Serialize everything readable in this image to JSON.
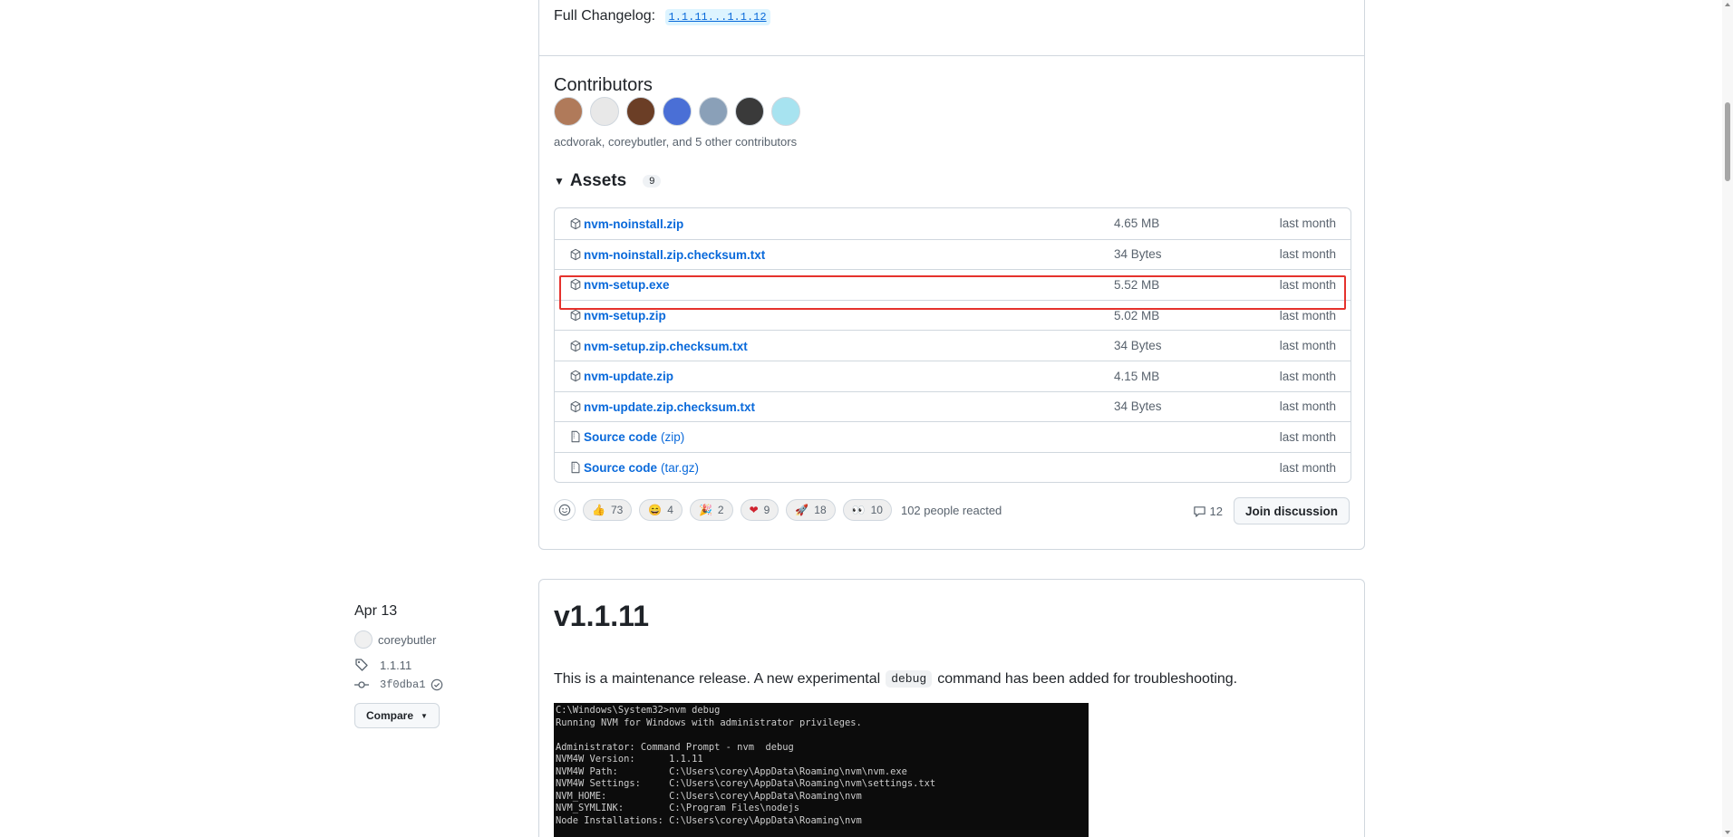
{
  "changelog": {
    "label": "Full Changelog:",
    "link": "1.1.11...1.1.12"
  },
  "contributors": {
    "title": "Contributors",
    "avatars": [
      {
        "name": "avatar-1",
        "color": "#b07a5a"
      },
      {
        "name": "avatar-2",
        "color": "#e8e8e8"
      },
      {
        "name": "avatar-3",
        "color": "#6b3e26"
      },
      {
        "name": "avatar-4",
        "color": "#4a6fd6"
      },
      {
        "name": "avatar-5",
        "color": "#8aa0b8"
      },
      {
        "name": "avatar-6",
        "color": "#3a3a3a"
      },
      {
        "name": "avatar-7",
        "color": "#a7e3f0"
      }
    ],
    "summary": "acdvorak, coreybutler, and 5 other contributors"
  },
  "assets": {
    "title": "Assets",
    "count": "9",
    "rows": [
      {
        "name": "nvm-noinstall.zip",
        "suffix": "",
        "size": "4.65 MB",
        "date": "last month",
        "icon": "package-icon"
      },
      {
        "name": "nvm-noinstall.zip.checksum.txt",
        "suffix": "",
        "size": "34 Bytes",
        "date": "last month",
        "icon": "package-icon"
      },
      {
        "name": "nvm-setup.exe",
        "suffix": "",
        "size": "5.52 MB",
        "date": "last month",
        "icon": "package-icon"
      },
      {
        "name": "nvm-setup.zip",
        "suffix": "",
        "size": "5.02 MB",
        "date": "last month",
        "icon": "package-icon"
      },
      {
        "name": "nvm-setup.zip.checksum.txt",
        "suffix": "",
        "size": "34 Bytes",
        "date": "last month",
        "icon": "package-icon"
      },
      {
        "name": "nvm-update.zip",
        "suffix": "",
        "size": "4.15 MB",
        "date": "last month",
        "icon": "package-icon"
      },
      {
        "name": "nvm-update.zip.checksum.txt",
        "suffix": "",
        "size": "34 Bytes",
        "date": "last month",
        "icon": "package-icon"
      },
      {
        "name": "Source code",
        "suffix": "(zip)",
        "size": "",
        "date": "last month",
        "icon": "file-zip-icon"
      },
      {
        "name": "Source code",
        "suffix": "(tar.gz)",
        "size": "",
        "date": "last month",
        "icon": "file-zip-icon"
      }
    ]
  },
  "reactions": {
    "items": [
      {
        "emoji": "👍",
        "count": "73",
        "name": "thumbs-up"
      },
      {
        "emoji": "😄",
        "count": "4",
        "name": "smile"
      },
      {
        "emoji": "🎉",
        "count": "2",
        "name": "tada"
      },
      {
        "emoji": "❤",
        "count": "9",
        "name": "heart"
      },
      {
        "emoji": "🚀",
        "count": "18",
        "name": "rocket"
      },
      {
        "emoji": "👀",
        "count": "10",
        "name": "eyes"
      }
    ],
    "summary": "102 people reacted",
    "comments": "12",
    "join_label": "Join discussion"
  },
  "release2": {
    "date": "Apr 13",
    "author": "coreybutler",
    "tag": "1.1.11",
    "commit": "3f0dba1",
    "compare_label": "Compare",
    "version": "v1.1.11",
    "desc_before": "This is a maintenance release. A new experimental",
    "desc_code": "debug",
    "desc_after": "command has been added for troubleshooting.",
    "terminal": "C:\\Windows\\System32>nvm debug\nRunning NVM for Windows with administrator privileges.\n\nAdministrator: Command Prompt - nvm  debug\nNVM4W Version:      1.1.11\nNVM4W Path:         C:\\Users\\corey\\AppData\\Roaming\\nvm\\nvm.exe\nNVM4W Settings:     C:\\Users\\corey\\AppData\\Roaming\\nvm\\settings.txt\nNVM_HOME:           C:\\Users\\corey\\AppData\\Roaming\\nvm\nNVM_SYMLINK:        C:\\Program Files\\nodejs\nNode Installations: C:\\Users\\corey\\AppData\\Roaming\\nvm"
  }
}
